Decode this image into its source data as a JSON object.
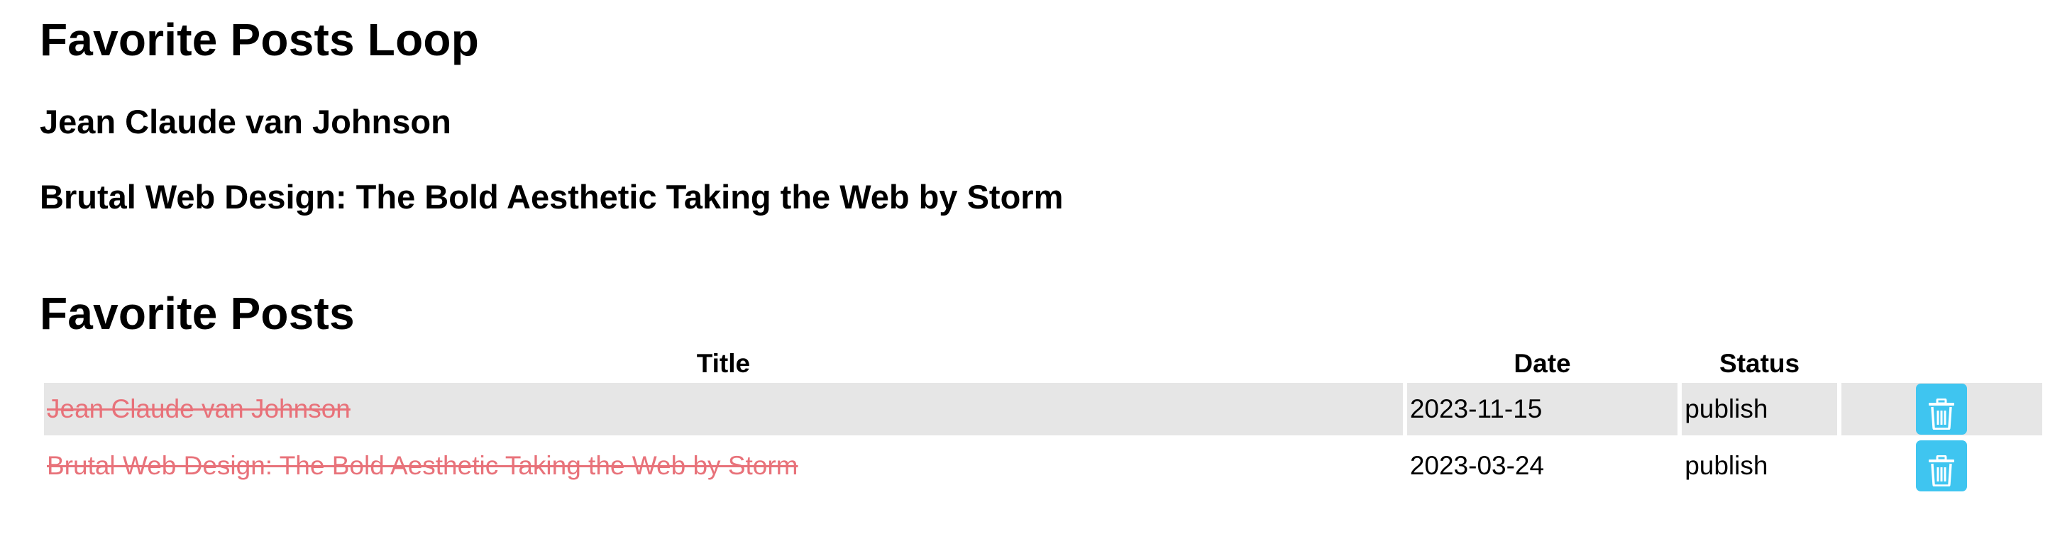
{
  "loop": {
    "heading": "Favorite Posts Loop",
    "items": [
      "Jean Claude van Johnson",
      "Brutal Web Design: The Bold Aesthetic Taking the Web by Storm"
    ]
  },
  "favorites": {
    "heading": "Favorite Posts",
    "columns": [
      "Title",
      "Date",
      "Status",
      ""
    ],
    "rows": [
      {
        "title": "Jean Claude van Johnson",
        "date": "2023-11-15",
        "status": "publish"
      },
      {
        "title": "Brutal Web Design: The Bold Aesthetic Taking the Web by Storm",
        "date": "2023-03-24",
        "status": "publish"
      }
    ]
  },
  "icons": {
    "delete": "trash-icon"
  },
  "colors": {
    "strikethrough_title": "#e8727a",
    "delete_button": "#3fc5f0",
    "row_highlight": "#e6e6e6"
  }
}
